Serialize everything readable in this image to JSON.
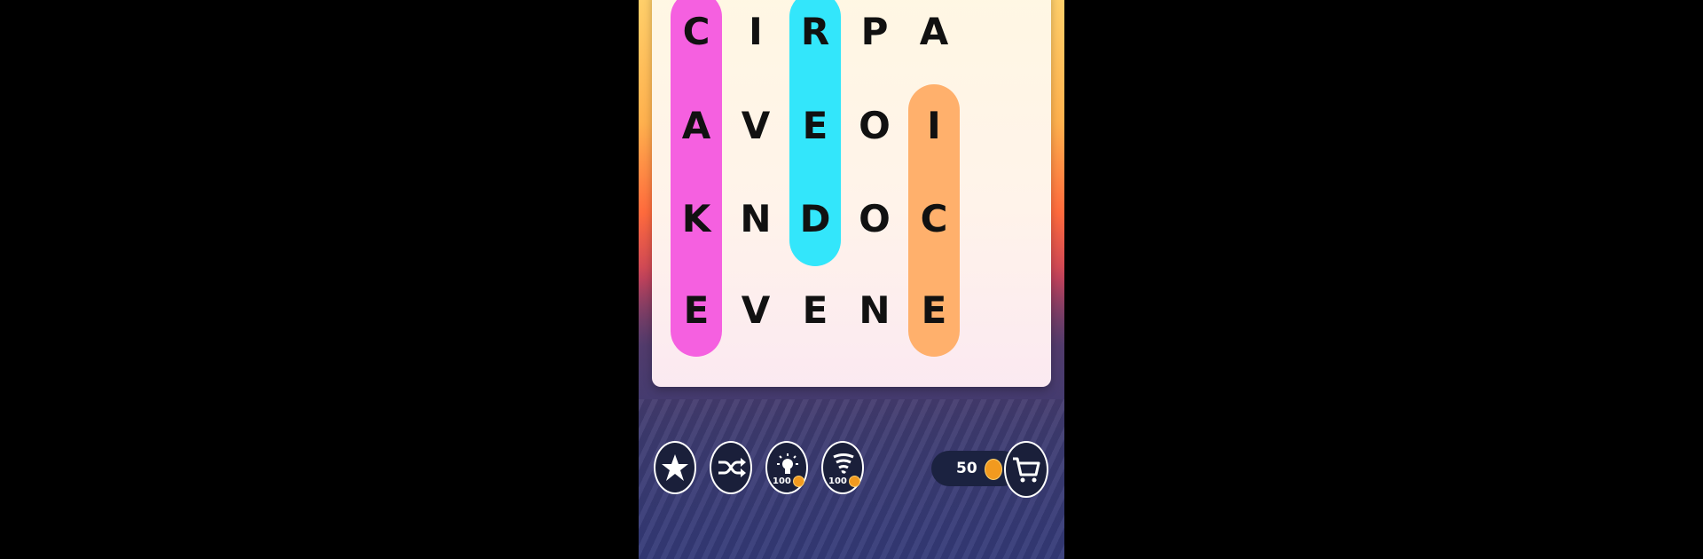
{
  "grid": [
    [
      "C",
      "I",
      "R",
      "P",
      "A"
    ],
    [
      "A",
      "V",
      "E",
      "O",
      "I"
    ],
    [
      "K",
      "N",
      "D",
      "O",
      "C"
    ],
    [
      "E",
      "V",
      "E",
      "N",
      "E"
    ]
  ],
  "found_words": [
    {
      "word": "CAKE",
      "color": "#f560e0"
    },
    {
      "word": "RED",
      "color": "#33e6fb"
    },
    {
      "word": "ICE",
      "color": "#ffb06c"
    }
  ],
  "toolbar": {
    "star_icon": "star-icon",
    "shuffle_icon": "shuffle-icon",
    "hint_icon": "lightbulb-icon",
    "hint_cost": "100",
    "tornado_icon": "tornado-icon",
    "tornado_cost": "100"
  },
  "coins": {
    "count": "50",
    "shop_icon": "cart-icon"
  }
}
